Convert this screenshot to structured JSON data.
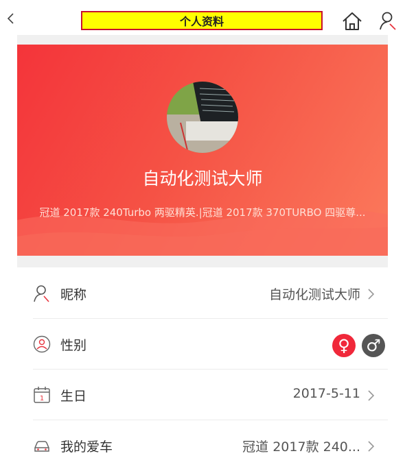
{
  "header": {
    "title": "个人资料"
  },
  "hero": {
    "name": "自动化测试大师",
    "cars": "冠道 2017款 240Turbo 两驱精英.|冠道 2017款 370TURBO 四驱尊..."
  },
  "profile": {
    "nickname": {
      "label": "昵称",
      "value": "自动化测试大师"
    },
    "gender": {
      "label": "性别",
      "female_symbol": "♀",
      "male_symbol": "♂",
      "selected": "female"
    },
    "birthday": {
      "label": "生日",
      "value": "2017-5-11",
      "calendar_day": "1"
    },
    "car": {
      "label": "我的爱车",
      "value": "冠道 2017款 240..."
    }
  },
  "colors": {
    "accent_red": "#f0283a",
    "hero_gradient_start": "#f4343a",
    "hero_gradient_end": "#fb7a5c",
    "title_bg": "#ffff00",
    "title_border": "#c8102e"
  }
}
